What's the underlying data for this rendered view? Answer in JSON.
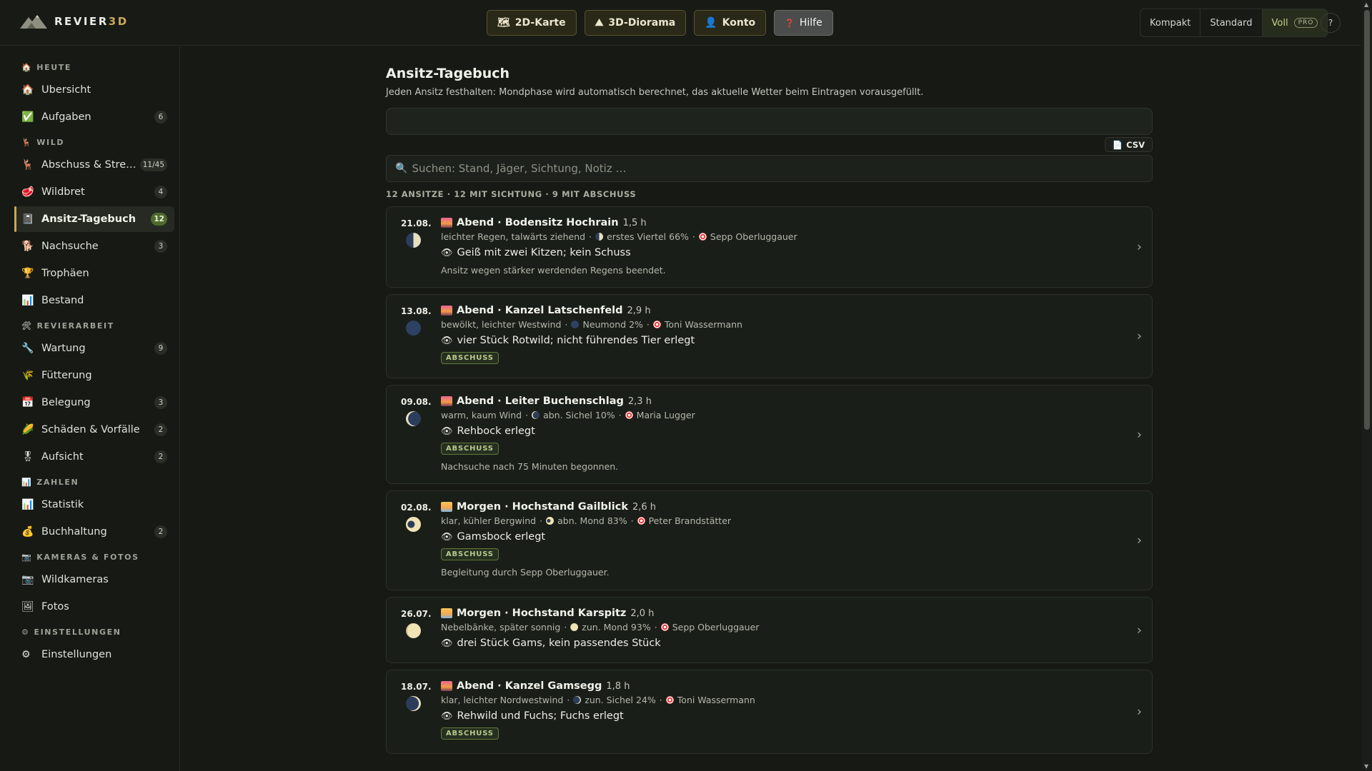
{
  "brand": {
    "name_main": "REVIER",
    "name_accent": "3D"
  },
  "topnav": {
    "buttons": [
      {
        "icon": "🗺",
        "label": "2D-Karte"
      },
      {
        "icon": "⛰",
        "label": "3D-Diorama"
      },
      {
        "icon": "👤",
        "label": "Konto"
      },
      {
        "icon": "❓",
        "label": "Hilfe"
      }
    ]
  },
  "view_switch": {
    "options": [
      "Kompakt",
      "Standard",
      "Voll"
    ],
    "active": "Voll",
    "pro_label": "PRO"
  },
  "help_circle": "?",
  "sidebar": {
    "sections": [
      {
        "icon": "🏠",
        "title": "HEUTE"
      },
      {
        "icon": "🦌",
        "title": "WILD"
      },
      {
        "icon": "🛠",
        "title": "REVIERARBEIT"
      },
      {
        "icon": "📊",
        "title": "ZAHLEN"
      },
      {
        "icon": "📷",
        "title": "KAMERAS & FOTOS"
      },
      {
        "icon": "⚙",
        "title": "EINSTELLUNGEN"
      }
    ],
    "items": [
      {
        "icon": "🏠",
        "label": "Übersicht",
        "count": ""
      },
      {
        "icon": "✅",
        "label": "Aufgaben",
        "count": "6"
      },
      {
        "icon": "🦌",
        "label": "Abschuss & Strecke",
        "count": "11/45"
      },
      {
        "icon": "🥩",
        "label": "Wildbret",
        "count": "4"
      },
      {
        "icon": "📓",
        "label": "Ansitz-Tagebuch",
        "count": "12"
      },
      {
        "icon": "🐕",
        "label": "Nachsuche",
        "count": "3"
      },
      {
        "icon": "🏆",
        "label": "Trophäen",
        "count": ""
      },
      {
        "icon": "📊",
        "label": "Bestand",
        "count": ""
      },
      {
        "icon": "🔧",
        "label": "Wartung",
        "count": "9"
      },
      {
        "icon": "🌾",
        "label": "Fütterung",
        "count": ""
      },
      {
        "icon": "📅",
        "label": "Belegung",
        "count": "3"
      },
      {
        "icon": "🌽",
        "label": "Schäden & Vorfälle",
        "count": "2"
      },
      {
        "icon": "🎖",
        "label": "Aufsicht",
        "count": "2"
      },
      {
        "icon": "📊",
        "label": "Statistik",
        "count": ""
      },
      {
        "icon": "💰",
        "label": "Buchhaltung",
        "count": "2"
      },
      {
        "icon": "📷",
        "label": "Wildkameras",
        "count": ""
      },
      {
        "icon": "🖼",
        "label": "Fotos",
        "count": ""
      },
      {
        "icon": "⚙",
        "label": "Einstellungen",
        "count": ""
      }
    ]
  },
  "main": {
    "title": "Ansitz-Tagebuch",
    "subtitle": "Jeden Ansitz festhalten: Mondphase wird automatisch berechnet, das aktuelle Wetter beim Eintragen vorausgefüllt.",
    "csv_label": "CSV",
    "search_placeholder": "Suchen: Stand, Jäger, Sichtung, Notiz …",
    "summary": "12 ANSITZE · 12 MIT SICHTUNG · 9 MIT ABSCHUSS",
    "badge_label": "ABSCHUSS",
    "entries": [
      {
        "date": "21.08.",
        "title": "Abend · Bodensitz Hochrain",
        "duration": "1,5 h",
        "weather": "leichter Regen, talwärts ziehend",
        "moon": "erstes Viertel 66%",
        "hunter": "Sepp Oberluggauer",
        "sighting": "Geiß mit zwei Kitzen; kein Schuss",
        "note": "Ansitz wegen stärker werdenden Regens beendet."
      },
      {
        "date": "13.08.",
        "title": "Abend · Kanzel Latschenfeld",
        "duration": "2,9 h",
        "weather": "bewölkt, leichter Westwind",
        "moon": "Neumond 2%",
        "hunter": "Toni Wassermann",
        "sighting": "vier Stück Rotwild; nicht führendes Tier erlegt",
        "note": ""
      },
      {
        "date": "09.08.",
        "title": "Abend · Leiter Buchenschlag",
        "duration": "2,3 h",
        "weather": "warm, kaum Wind",
        "moon": "abn. Sichel 10%",
        "hunter": "Maria Lugger",
        "sighting": "Rehbock erlegt",
        "note": "Nachsuche nach 75 Minuten begonnen."
      },
      {
        "date": "02.08.",
        "title": "Morgen · Hochstand Gailblick",
        "duration": "2,6 h",
        "weather": "klar, kühler Bergwind",
        "moon": "abn. Mond 83%",
        "hunter": "Peter Brandstätter",
        "sighting": "Gamsbock erlegt",
        "note": "Begleitung durch Sepp Oberluggauer."
      },
      {
        "date": "26.07.",
        "title": "Morgen · Hochstand Karspitz",
        "duration": "2,0 h",
        "weather": "Nebelbänke, später sonnig",
        "moon": "zun. Mond 93%",
        "hunter": "Sepp Oberluggauer",
        "sighting": "drei Stück Gams, kein passendes Stück",
        "note": ""
      },
      {
        "date": "18.07.",
        "title": "Abend · Kanzel Gamsegg",
        "duration": "1,8 h",
        "weather": "klar, leichter Nordwestwind",
        "moon": "zun. Sichel 24%",
        "hunter": "Toni Wassermann",
        "sighting": "Rehwild und Fuchs; Fuchs erlegt",
        "note": ""
      }
    ]
  },
  "colors": {
    "accent": "#c9a85a",
    "badge": "#b8c98d",
    "background": "#161914"
  }
}
